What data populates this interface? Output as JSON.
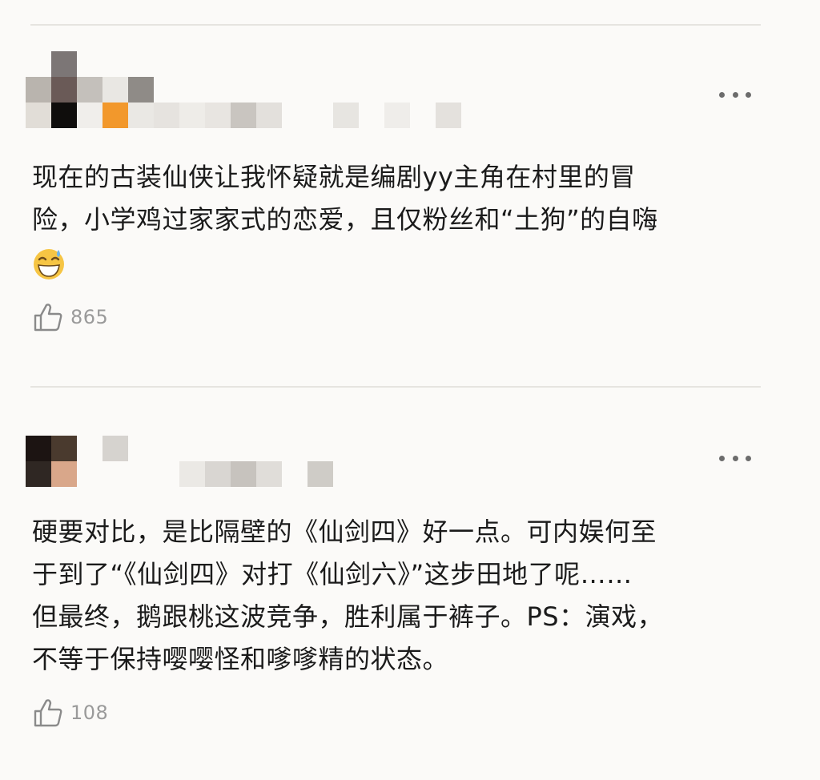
{
  "colors": {
    "background": "#fbfaf8",
    "text": "#1b1b1b",
    "muted": "#9a9a9a",
    "divider": "#e6e4e0",
    "dots": "#6c6c6c"
  },
  "comments": [
    {
      "text_lines": [
        "现在的古装仙侠让我怀疑就是编剧yy主角在村里的冒",
        "险，小学鸡过家家式的恋爱，且仅粉丝和“土狗”的自嗨"
      ],
      "emoji": "grinning-sweat-face",
      "likes": "865",
      "more_icon": "more-dots-icon"
    },
    {
      "text_lines": [
        "硬要对比，是比隔壁的《仙剑四》好一点。可内娱何至",
        "于到了“《仙剑四》对打《仙剑六》”这步田地了呢……",
        "但最终，鹅跟桃这波竞争，胜利属于裤子。PS：演戏，",
        "不等于保持嘤嘤怪和嗲嗲精的状态。"
      ],
      "likes": "108",
      "more_icon": "more-dots-icon"
    }
  ]
}
